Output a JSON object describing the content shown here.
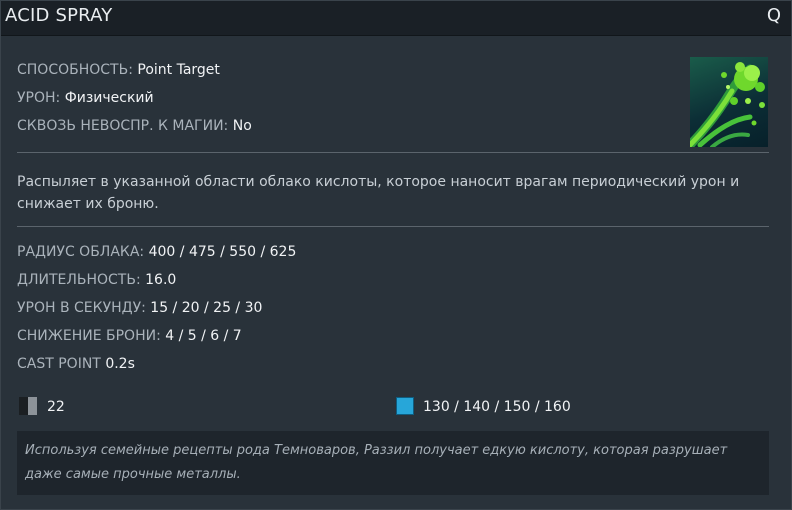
{
  "ability": {
    "name": "ACID SPRAY",
    "hotkey": "Q"
  },
  "properties": [
    {
      "label": "СПОСОБНОСТЬ:",
      "value": "Point Target"
    },
    {
      "label": "УРОН:",
      "value": "Физический"
    },
    {
      "label": "СКВОЗЬ НЕВОСПР. К МАГИИ:",
      "value": "No"
    }
  ],
  "icon": {
    "name": "acid-spray-ability-icon"
  },
  "description": "Распыляет в указанной области облако кислоты, которое наносит врагам периодический урон и снижает их броню.",
  "stats": [
    {
      "label": "РАДИУС ОБЛАКА:",
      "value": "400 / 475 / 550 / 625"
    },
    {
      "label": "ДЛИТЕЛЬНОСТЬ:",
      "value": "16.0"
    },
    {
      "label": "УРОН В СЕКУНДУ:",
      "value": "15 / 20 / 25 / 30"
    },
    {
      "label": "СНИЖЕНИЕ БРОНИ:",
      "value": "4 / 5 / 6 / 7"
    },
    {
      "label": "CAST POINT",
      "value": "0.2s"
    }
  ],
  "costs": {
    "cooldown": {
      "icon": "cooldown-icon",
      "value": "22"
    },
    "mana": {
      "icon": "mana-icon",
      "value": "130 / 140 / 150 / 160"
    }
  },
  "lore": "Используя семейные рецепты рода Темноваров, Раззил получает едкую кислоту, которая разрушает даже самые прочные металлы.",
  "colors": {
    "background": "#29323a",
    "header": "#1a2026",
    "mana": "#27a6d9",
    "acid": "#5fd02a"
  }
}
